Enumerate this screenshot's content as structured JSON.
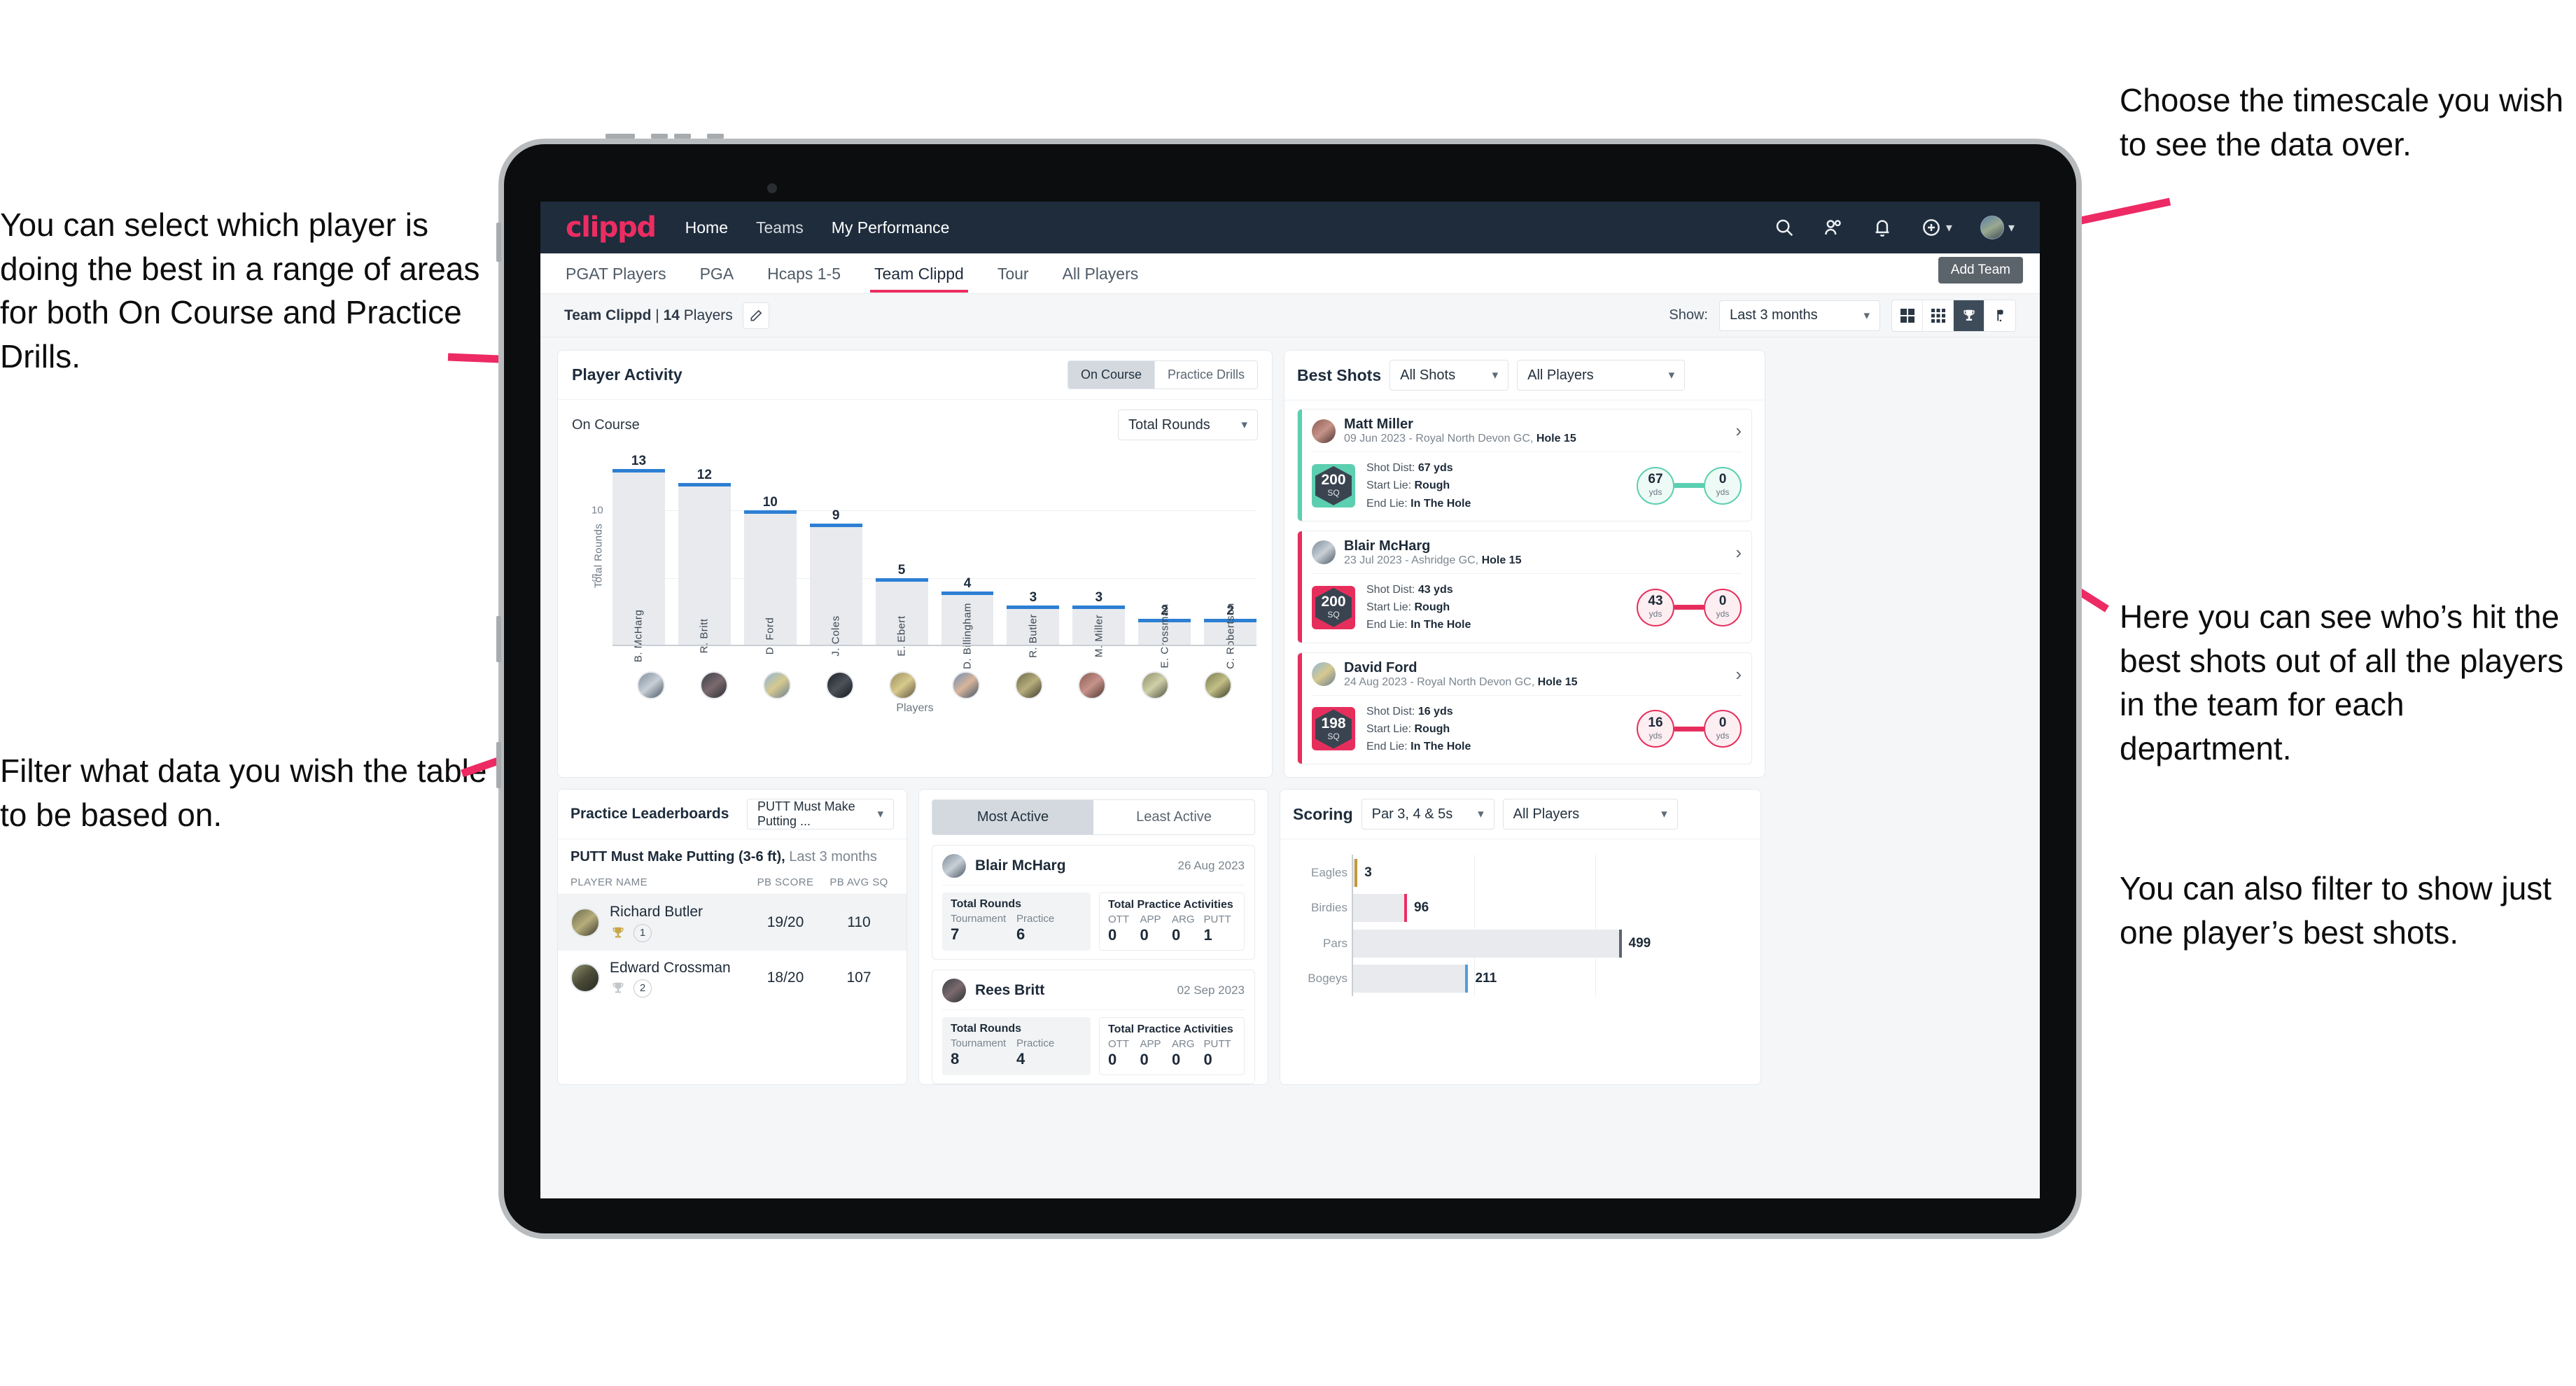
{
  "annotations": {
    "left_top": "You can select which player is doing the best in a range of areas for both On Course and Practice Drills.",
    "left_bottom": "Filter what data you wish the table to be based on.",
    "right_top": "Choose the timescale you wish to see the data over.",
    "right_mid": "Here you can see who’s hit the best shots out of all the players in the team for each department.",
    "right_bottom": "You can also filter to show just one player’s best shots."
  },
  "navbar": {
    "logo": "clippd",
    "links": [
      {
        "label": "Home",
        "active": true
      },
      {
        "label": "Teams",
        "active": false
      },
      {
        "label": "My Performance",
        "active": true
      }
    ],
    "icons": [
      "search-icon",
      "people-icon",
      "bell-icon",
      "plus-circle-icon",
      "avatar"
    ]
  },
  "subtabs": {
    "items": [
      {
        "label": "PGAT Players",
        "active": false
      },
      {
        "label": "PGA",
        "active": false
      },
      {
        "label": "Hcaps 1-5",
        "active": false
      },
      {
        "label": "Team Clippd",
        "active": true
      },
      {
        "label": "Tour",
        "active": false
      },
      {
        "label": "All Players",
        "active": false
      }
    ],
    "tooltip": "Add Team"
  },
  "toolbar": {
    "team_name": "Team Clippd",
    "separator": " | ",
    "player_count": "14",
    "players_word": " Players",
    "show_label": "Show:",
    "timescale_value": "Last 3 months",
    "view_icons": [
      "grid-large-icon",
      "grid-small-icon",
      "trophy-icon",
      "flag-icon"
    ]
  },
  "player_activity": {
    "title": "Player Activity",
    "segments": [
      {
        "label": "On Course",
        "active": true
      },
      {
        "label": "Practice Drills",
        "active": false
      }
    ],
    "sub_label": "On Course",
    "metric_value": "Total Rounds"
  },
  "best_shots": {
    "title": "Best Shots",
    "shot_filter": "All Shots",
    "player_filter": "All Players",
    "items": [
      {
        "name": "Matt Miller",
        "meta_date": "09 Jun 2023 - Royal North Devon GC, ",
        "meta_hole": "Hole 15",
        "sq": "200",
        "sq_unit": "SQ",
        "accent": "#5ccfb0",
        "shot_dist_label": "Shot Dist: ",
        "shot_dist": "67 yds",
        "start_lie_label": "Start Lie: ",
        "start_lie": "Rough",
        "end_lie_label": "End Lie: ",
        "end_lie": "In The Hole",
        "from_num": "67",
        "from_unit": "yds",
        "to_num": "0",
        "to_unit": "yds"
      },
      {
        "name": "Blair McHarg",
        "meta_date": "23 Jul 2023 - Ashridge GC, ",
        "meta_hole": "Hole 15",
        "sq": "200",
        "sq_unit": "SQ",
        "accent": "#e62e5c",
        "shot_dist_label": "Shot Dist: ",
        "shot_dist": "43 yds",
        "start_lie_label": "Start Lie: ",
        "start_lie": "Rough",
        "end_lie_label": "End Lie: ",
        "end_lie": "In The Hole",
        "from_num": "43",
        "from_unit": "yds",
        "to_num": "0",
        "to_unit": "yds"
      },
      {
        "name": "David Ford",
        "meta_date": "24 Aug 2023 - Royal North Devon GC, ",
        "meta_hole": "Hole 15",
        "sq": "198",
        "sq_unit": "SQ",
        "accent": "#e62e5c",
        "shot_dist_label": "Shot Dist: ",
        "shot_dist": "16 yds",
        "start_lie_label": "Start Lie: ",
        "start_lie": "Rough",
        "end_lie_label": "End Lie: ",
        "end_lie": "In The Hole",
        "from_num": "16",
        "from_unit": "yds",
        "to_num": "0",
        "to_unit": "yds"
      }
    ]
  },
  "practice_leaderboards": {
    "title": "Practice Leaderboards",
    "drill_value": "PUTT Must Make Putting ...",
    "subtitle_bold": "PUTT Must Make Putting (3-6 ft),",
    "subtitle_rest": " Last 3 months",
    "columns": [
      "PLAYER NAME",
      "PB SCORE",
      "PB AVG SQ"
    ],
    "rows": [
      {
        "name": "Richard Butler",
        "rank": "1",
        "pb_score": "19/20",
        "pb_avg_sq": "110",
        "trophy": "gold"
      },
      {
        "name": "Edward Crossman",
        "rank": "2",
        "pb_score": "18/20",
        "pb_avg_sq": "107",
        "trophy": "silver"
      }
    ]
  },
  "activity": {
    "tabs": [
      {
        "label": "Most Active",
        "active": true
      },
      {
        "label": "Least Active",
        "active": false
      }
    ],
    "rounds_title": "Total Rounds",
    "practice_title": "Total Practice Activities",
    "rounds_keys": [
      "Tournament",
      "Practice"
    ],
    "practice_keys": [
      "OTT",
      "APP",
      "ARG",
      "PUTT"
    ],
    "items": [
      {
        "name": "Blair McHarg",
        "date": "26 Aug 2023",
        "rounds": [
          "7",
          "6"
        ],
        "practice": [
          "0",
          "0",
          "0",
          "1"
        ]
      },
      {
        "name": "Rees Britt",
        "date": "02 Sep 2023",
        "rounds": [
          "8",
          "4"
        ],
        "practice": [
          "0",
          "0",
          "0",
          "0"
        ]
      }
    ]
  },
  "scoring": {
    "title": "Scoring",
    "par_filter": "Par 3, 4 & 5s",
    "player_filter": "All Players"
  },
  "chart_data": [
    {
      "type": "bar",
      "title": "Player Activity - On Course",
      "xlabel": "Players",
      "ylabel": "Total Rounds",
      "ylim": [
        0,
        14
      ],
      "yticks": [
        5,
        10
      ],
      "grid": true,
      "categories": [
        "B. McHarg",
        "R. Britt",
        "D. Ford",
        "J. Coles",
        "E. Ebert",
        "D. Billingham",
        "R. Butler",
        "M. Miller",
        "E. Crossman",
        "C. Robertson"
      ],
      "values": [
        13,
        12,
        10,
        9,
        5,
        4,
        3,
        3,
        2,
        2
      ],
      "bar_color": "#e8eaee",
      "cap_color": "#2d7fd3"
    },
    {
      "type": "bar",
      "orientation": "horizontal",
      "title": "Scoring",
      "xlabel": "",
      "ylabel": "",
      "categories": [
        "Eagles",
        "Birdies",
        "Pars",
        "Bogeys"
      ],
      "values": [
        3,
        96,
        499,
        211
      ],
      "colors": [
        "#c29a3c",
        "#ec2d62",
        "#5c6570",
        "#4f9de0"
      ],
      "xlim": [
        0,
        660
      ],
      "grid": true
    }
  ]
}
